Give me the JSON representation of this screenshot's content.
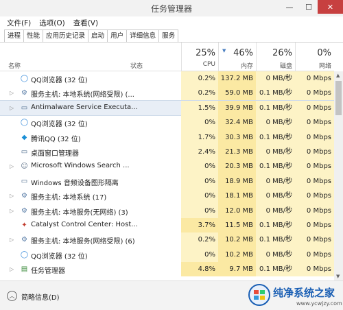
{
  "window": {
    "title": "任务管理器",
    "min": "—",
    "max": "☐",
    "close": "✕"
  },
  "menu": [
    "文件(F)",
    "选项(O)",
    "查看(V)"
  ],
  "tabs": [
    "进程",
    "性能",
    "应用历史记录",
    "启动",
    "用户",
    "详细信息",
    "服务"
  ],
  "header": {
    "name_col": "名称",
    "status_col": "状态",
    "cpu": {
      "pct": "25%",
      "label": "CPU"
    },
    "mem": {
      "pct": "46%",
      "label": "内存"
    },
    "disk": {
      "pct": "26%",
      "label": "磁盘"
    },
    "net": {
      "pct": "0%",
      "label": "网络"
    }
  },
  "rows": [
    {
      "name": "QQ浏览器 (32 位)",
      "icon": "qq-browser-icon",
      "expand": "",
      "cpu": "0.2%",
      "mem": "137.2 MB",
      "disk": "0 MB/秒",
      "net": "0 Mbps"
    },
    {
      "name": "服务主机: 本地系统(网络受限) (...",
      "icon": "gear-icon",
      "expand": "▷",
      "cpu": "0.2%",
      "mem": "59.0 MB",
      "disk": "0.1 MB/秒",
      "net": "0 Mbps"
    },
    {
      "name": "Antimalware Service Executa...",
      "icon": "window-icon",
      "expand": "▷",
      "cpu": "1.5%",
      "mem": "39.9 MB",
      "disk": "0.1 MB/秒",
      "net": "0 Mbps",
      "selected": true
    },
    {
      "name": "QQ浏览器 (32 位)",
      "icon": "qq-browser-icon",
      "expand": "",
      "cpu": "0%",
      "mem": "32.4 MB",
      "disk": "0 MB/秒",
      "net": "0 Mbps"
    },
    {
      "name": "腾讯QQ (32 位)",
      "icon": "qq-icon",
      "expand": "",
      "cpu": "1.7%",
      "mem": "30.3 MB",
      "disk": "0.1 MB/秒",
      "net": "0 Mbps"
    },
    {
      "name": "桌面窗口管理器",
      "icon": "window-icon",
      "expand": "",
      "cpu": "2.4%",
      "mem": "21.3 MB",
      "disk": "0 MB/秒",
      "net": "0 Mbps"
    },
    {
      "name": "Microsoft Windows Search ...",
      "icon": "search-user-icon",
      "expand": "▷",
      "cpu": "0%",
      "mem": "20.3 MB",
      "disk": "0.1 MB/秒",
      "net": "0 Mbps"
    },
    {
      "name": "Windows 音频设备图形隔离",
      "icon": "window-icon",
      "expand": "",
      "cpu": "0%",
      "mem": "18.9 MB",
      "disk": "0 MB/秒",
      "net": "0 Mbps"
    },
    {
      "name": "服务主机: 本地系统 (17)",
      "icon": "gear-icon",
      "expand": "▷",
      "cpu": "0%",
      "mem": "18.1 MB",
      "disk": "0 MB/秒",
      "net": "0 Mbps"
    },
    {
      "name": "服务主机: 本地服务(无网络) (3)",
      "icon": "gear-icon",
      "expand": "▷",
      "cpu": "0%",
      "mem": "12.0 MB",
      "disk": "0 MB/秒",
      "net": "0 Mbps"
    },
    {
      "name": "Catalyst Control Center: Host...",
      "icon": "catalyst-icon",
      "expand": "",
      "cpu": "3.7%",
      "mem": "11.5 MB",
      "disk": "0.1 MB/秒",
      "net": "0 Mbps"
    },
    {
      "name": "服务主机: 本地服务(网络受限) (6)",
      "icon": "gear-icon",
      "expand": "▷",
      "cpu": "0.2%",
      "mem": "10.2 MB",
      "disk": "0.1 MB/秒",
      "net": "0 Mbps"
    },
    {
      "name": "QQ浏览器 (32 位)",
      "icon": "qq-browser-icon",
      "expand": "",
      "cpu": "0%",
      "mem": "10.2 MB",
      "disk": "0 MB/秒",
      "net": "0 Mbps"
    },
    {
      "name": "任务管理器",
      "icon": "task-manager-icon",
      "expand": "▷",
      "cpu": "4.8%",
      "mem": "9.7 MB",
      "disk": "0.1 MB/秒",
      "net": "0 Mbps"
    }
  ],
  "footer": {
    "fewer_details": "简略信息(D)"
  },
  "brand": {
    "name": "纯净系统之家",
    "url": "www.ycwjzy.com"
  },
  "colors": {
    "heat_light": "#fdf3c6",
    "heat_mid": "#fbe9a3",
    "selected_row": "#e8eef6",
    "close_btn": "#c74040"
  }
}
